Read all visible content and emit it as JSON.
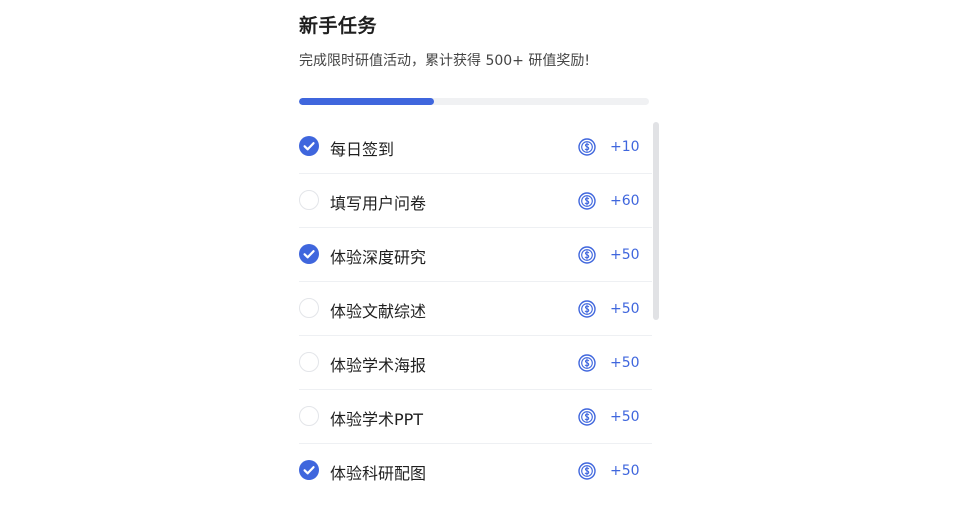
{
  "header": {
    "title": "新手任务",
    "subtitle": "完成限时研值活动，累计获得 500+ 研值奖励!"
  },
  "progress": {
    "fraction": 0.385
  },
  "colors": {
    "accent": "#3f66dd",
    "track": "#f0f1f3",
    "text": "#1f1f1f"
  },
  "tasks": [
    {
      "label": "每日签到",
      "reward": "+10",
      "done": true,
      "icon": "coin-icon"
    },
    {
      "label": "填写用户问卷",
      "reward": "+60",
      "done": false,
      "icon": "coin-icon"
    },
    {
      "label": "体验深度研究",
      "reward": "+50",
      "done": true,
      "icon": "coin-icon"
    },
    {
      "label": "体验文献综述",
      "reward": "+50",
      "done": false,
      "icon": "coin-icon"
    },
    {
      "label": "体验学术海报",
      "reward": "+50",
      "done": false,
      "icon": "coin-icon"
    },
    {
      "label": "体验学术PPT",
      "reward": "+50",
      "done": false,
      "icon": "coin-icon"
    },
    {
      "label": "体验科研配图",
      "reward": "+50",
      "done": true,
      "icon": "coin-icon"
    }
  ]
}
